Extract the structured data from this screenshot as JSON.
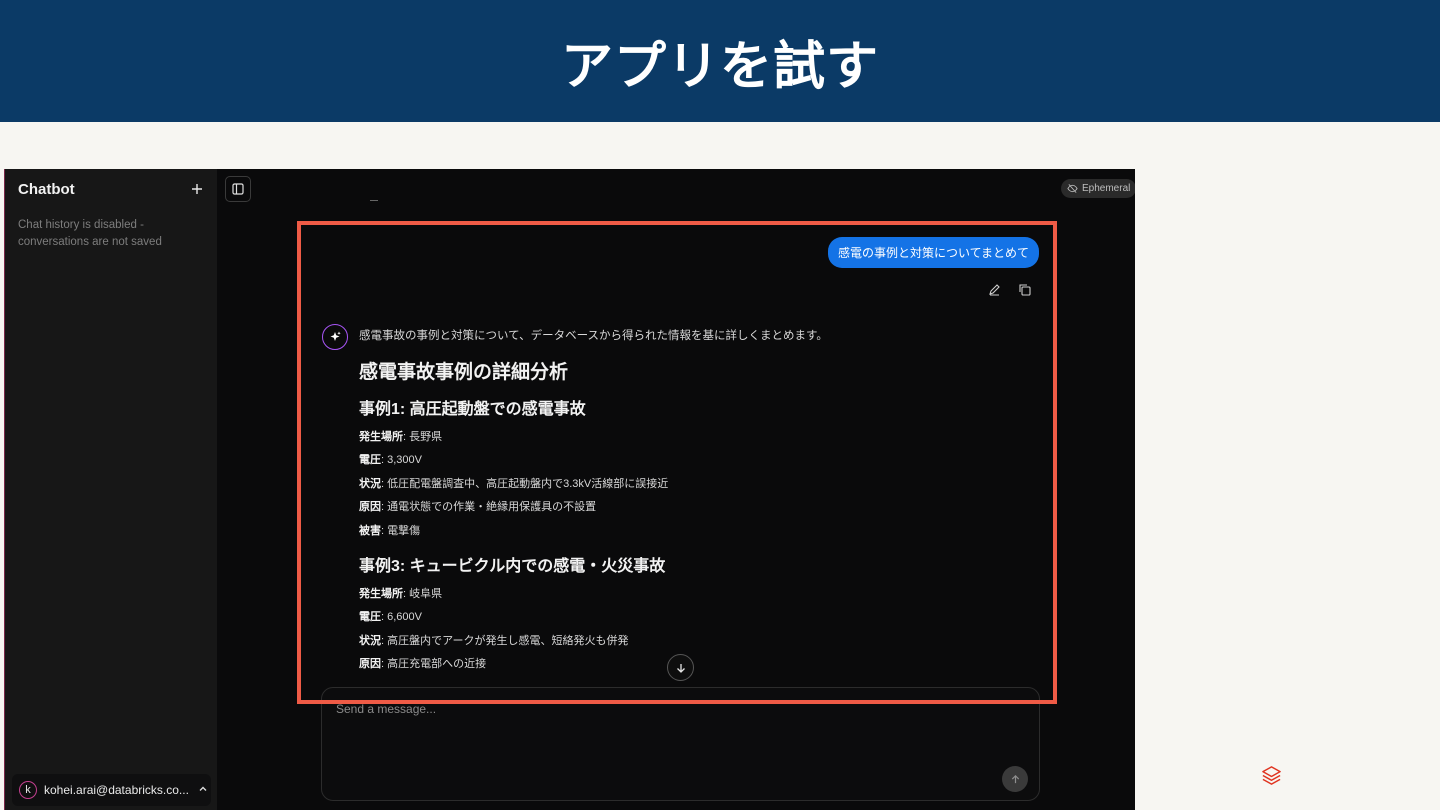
{
  "slide": {
    "title": "アプリを試す"
  },
  "sidebar": {
    "title": "Chatbot",
    "new_chat_icon": "plus-icon",
    "note": "Chat history is disabled - conversations are not saved",
    "user": {
      "initial": "k",
      "email": "kohei.arai@databricks.co...",
      "menu_icon": "chevron-up-icon"
    }
  },
  "topbar": {
    "toggle_icon": "sidebar-toggle-icon",
    "badge": "Ephemeral",
    "badge_icon": "eye-off-icon"
  },
  "chat": {
    "user_message": "感電の事例と対策についてまとめて",
    "actions": {
      "edit_icon": "pencil-icon",
      "copy_icon": "copy-icon"
    },
    "assistant": {
      "avatar_icon": "sparkles-icon",
      "intro": "感電事故の事例と対策について、データベースから得られた情報を基に詳しくまとめます。",
      "heading": "感電事故事例の詳細分析",
      "case1": {
        "title": "事例1: 高圧起動盤での感電事故",
        "fields": [
          {
            "label": "発生場所",
            "value": ": 長野県"
          },
          {
            "label": "電圧",
            "value": ": 3,300V"
          },
          {
            "label": "状況",
            "value": ": 低圧配電盤調査中、高圧起動盤内で3.3kV活線部に誤接近"
          },
          {
            "label": "原因",
            "value": ": 通電状態での作業・絶縁用保護具の不設置"
          },
          {
            "label": "被害",
            "value": ": 電撃傷"
          }
        ]
      },
      "case3": {
        "title": "事例3: キュービクル内での感電・火災事故",
        "fields": [
          {
            "label": "発生場所",
            "value": ": 岐阜県"
          },
          {
            "label": "電圧",
            "value": ": 6,600V"
          },
          {
            "label": "状況",
            "value": ": 高圧盤内でアークが発生し感電、短絡発火も併発"
          },
          {
            "label": "原因",
            "value": ": 高圧充電部への近接"
          }
        ]
      }
    },
    "scroll_icon": "arrow-down-icon"
  },
  "composer": {
    "placeholder": "Send a message...",
    "send_icon": "arrow-up-icon"
  },
  "colors": {
    "header": "#0b3a66",
    "accent": "#1473e6",
    "highlight": "#ef5b46",
    "brand": "#e0331f"
  },
  "footer": {
    "logo_icon": "databricks-logo-icon"
  }
}
